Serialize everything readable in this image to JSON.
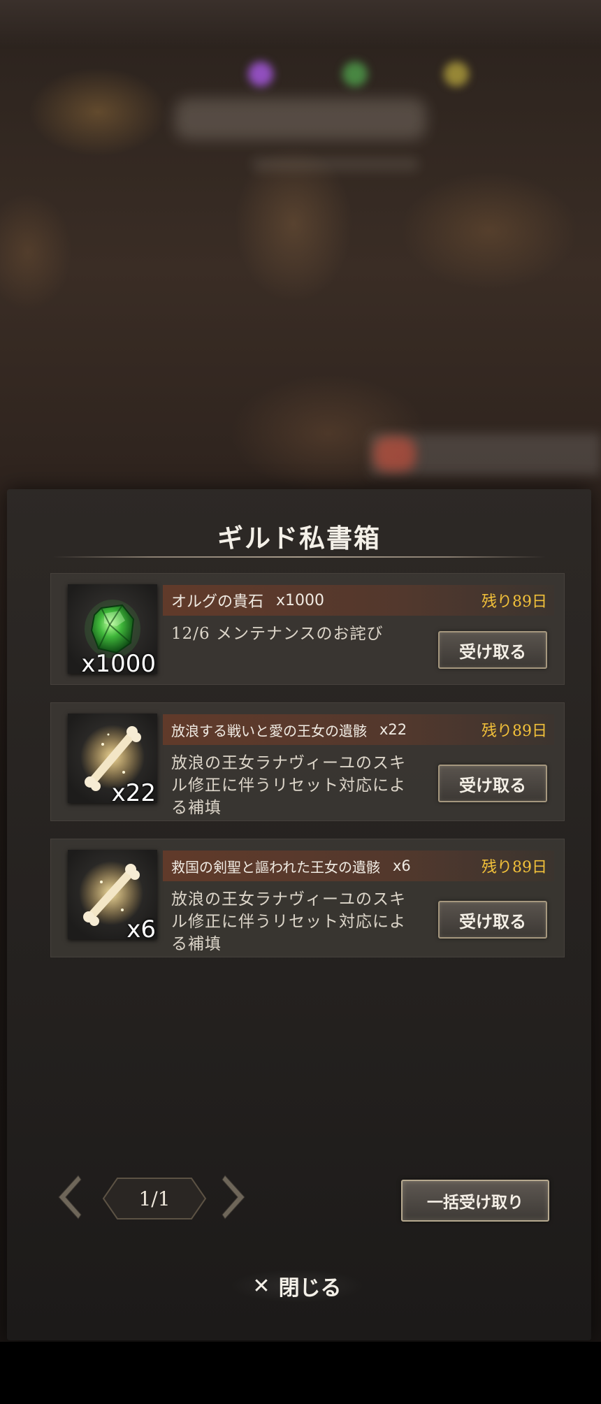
{
  "modal": {
    "title": "ギルド私書箱"
  },
  "items": [
    {
      "icon": "green-gem-icon",
      "qty_badge": "x1000",
      "name": "オルグの貴石",
      "name_qty": "x1000",
      "remaining": "残り89日",
      "description": "12/6 メンテナンスのお詫び",
      "claim_label": "受け取る"
    },
    {
      "icon": "bone-relic-icon",
      "qty_badge": "x22",
      "name": "放浪する戦いと愛の王女の遺骸",
      "name_qty": "x22",
      "remaining": "残り89日",
      "description": "放浪の王女ラナヴィーユのスキル修正に伴うリセット対応による補填",
      "claim_label": "受け取る"
    },
    {
      "icon": "bone-relic-icon",
      "qty_badge": "x6",
      "name": "救国の剣聖と謳われた王女の遺骸",
      "name_qty": "x6",
      "remaining": "残り89日",
      "description": "放浪の王女ラナヴィーユのスキル修正に伴うリセット対応による補填",
      "claim_label": "受け取る"
    }
  ],
  "pager": {
    "page": "1/1",
    "prev_icon": "chevron-left-icon",
    "next_icon": "chevron-right-icon"
  },
  "claim_all_label": "一括受け取り",
  "close": {
    "icon_glyph": "✕",
    "label": "閉じる"
  },
  "colors": {
    "remaining_text": "#f2c13a",
    "header_band": "#6e3c28",
    "button_border": "#a5977e"
  }
}
